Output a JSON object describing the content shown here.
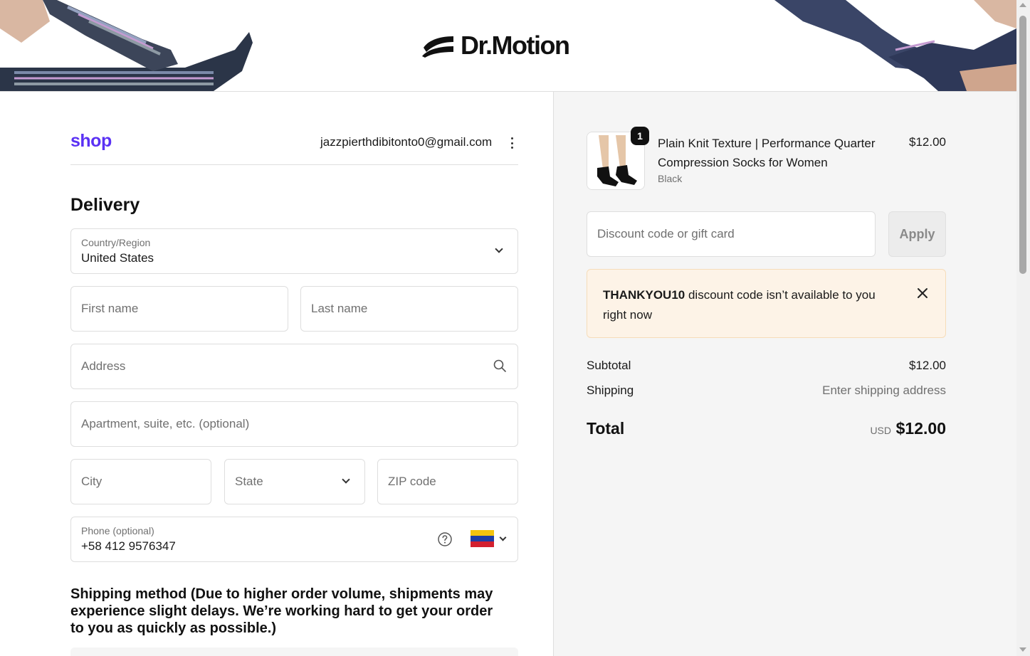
{
  "brand": {
    "name": "Dr.Motion"
  },
  "account": {
    "shop_logo": "shop",
    "email": "jazzpierthdibitonto0@gmail.com"
  },
  "delivery": {
    "title": "Delivery",
    "country": {
      "label": "Country/Region",
      "value": "United States"
    },
    "first_name": {
      "placeholder": "First name"
    },
    "last_name": {
      "placeholder": "Last name"
    },
    "address": {
      "placeholder": "Address"
    },
    "apartment": {
      "placeholder": "Apartment, suite, etc. (optional)"
    },
    "city": {
      "placeholder": "City"
    },
    "state": {
      "placeholder": "State"
    },
    "zip": {
      "placeholder": "ZIP code"
    },
    "phone": {
      "label": "Phone (optional)",
      "value": "+58 412 9576347"
    },
    "shipping_method_title": "Shipping method (Due to higher order volume, shipments may experience slight delays. We’re working hard to get your order to you as quickly as possible.)"
  },
  "summary": {
    "product": {
      "quantity": "1",
      "name": "Plain Knit Texture | Performance Quarter Compression Socks for Women",
      "variant": "Black",
      "price": "$12.00"
    },
    "discount": {
      "placeholder": "Discount code or gift card",
      "apply_label": "Apply"
    },
    "alert": {
      "code": "THANKYOU10",
      "message": " discount code isn’t available to you right now"
    },
    "subtotal": {
      "label": "Subtotal",
      "value": "$12.00"
    },
    "shipping": {
      "label": "Shipping",
      "value": "Enter shipping address"
    },
    "total": {
      "label": "Total",
      "currency": "USD",
      "value": "$12.00"
    }
  },
  "colors": {
    "shop_purple": "#5a31f4",
    "alert_bg": "#fdf3e7",
    "summary_bg": "#f5f5f5",
    "flag_yellow": "#f4c40f",
    "flag_blue": "#1e3ea5",
    "flag_red": "#d3202f"
  },
  "icons": [
    "dr-motion-logo-icon",
    "kebab-menu-icon",
    "chevron-down-icon",
    "search-icon",
    "help-circle-icon",
    "venezuela-flag-icon",
    "close-icon"
  ]
}
